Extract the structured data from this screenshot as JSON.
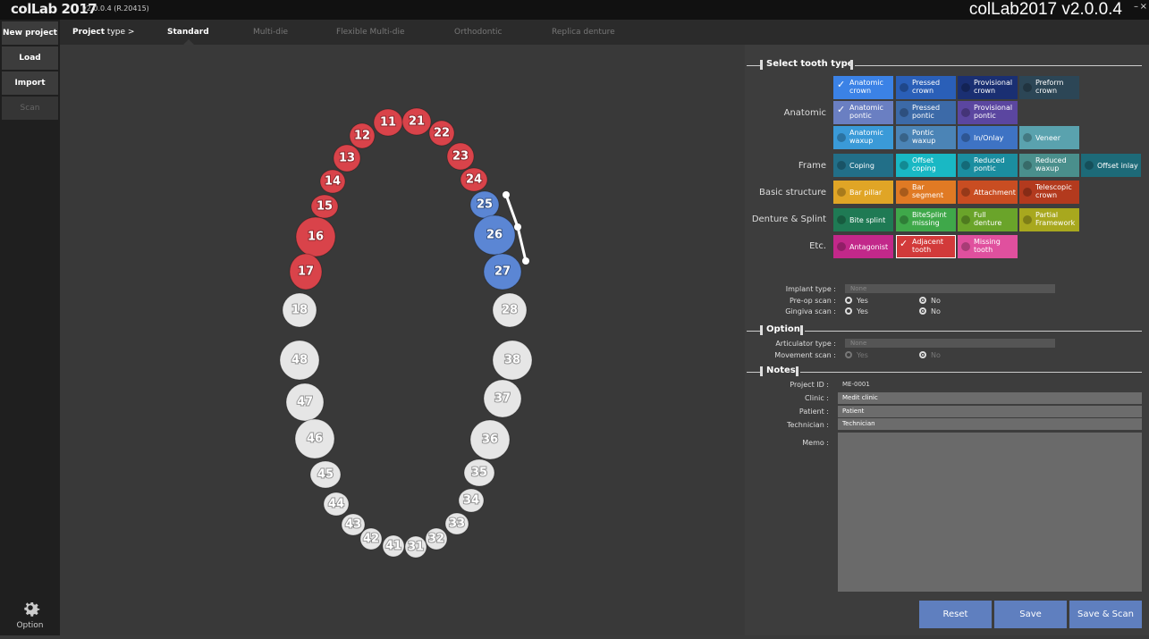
{
  "title": {
    "logo": "colLab 2017",
    "version": "v2.0.0.4 (R.20415)",
    "right_title": "colLab2017 v2.0.0.4",
    "close_glyph": "×",
    "min_glyph": "–"
  },
  "sidebar": {
    "items": [
      {
        "label": "New project"
      },
      {
        "label": "Load"
      },
      {
        "label": "Import"
      },
      {
        "label": "Scan"
      }
    ],
    "option_label": "Option"
  },
  "nav": {
    "project_label": "Project",
    "project_suffix": "type >",
    "tabs": [
      {
        "label": "Standard"
      },
      {
        "label": "Multi-die"
      },
      {
        "label": "Flexible Multi-die"
      },
      {
        "label": "Orthodontic"
      },
      {
        "label": "Replica denture"
      }
    ]
  },
  "teeth": {
    "red": [
      "11",
      "21",
      "12",
      "22",
      "13",
      "23",
      "14",
      "24",
      "15",
      "16",
      "17"
    ],
    "blue": [
      "25",
      "26",
      "27"
    ],
    "white": [
      "18",
      "28",
      "48",
      "38",
      "47",
      "37",
      "46",
      "36",
      "45",
      "35",
      "44",
      "34",
      "43",
      "33",
      "42",
      "32",
      "41",
      "31"
    ]
  },
  "tooth_type": {
    "header": "Select tooth type",
    "rows": [
      {
        "label": "Anatomic"
      },
      {
        "label": "Frame"
      },
      {
        "label": "Basic structure"
      },
      {
        "label": "Denture & Splint"
      },
      {
        "label": "Etc."
      }
    ],
    "buttons": [
      {
        "l1": "Anatomic",
        "l2": "crown",
        "color": "#3b82e6"
      },
      {
        "l1": "Pressed",
        "l2": "crown",
        "color": "#2a5fb8"
      },
      {
        "l1": "Provisional",
        "l2": "crown",
        "color": "#1a2f72"
      },
      {
        "l1": "Preform",
        "l2": "crown",
        "color": "#2c4656"
      },
      {
        "l1": "Anatomic",
        "l2": "pontic",
        "color": "#6a7fc2"
      },
      {
        "l1": "Pressed",
        "l2": "pontic",
        "color": "#3c6aa8"
      },
      {
        "l1": "Provisional",
        "l2": "pontic",
        "color": "#5b46a0"
      },
      {
        "l1": "Anatomic",
        "l2": "waxup",
        "color": "#3a9ad8"
      },
      {
        "l1": "Pontic",
        "l2": "waxup",
        "color": "#4b84b6"
      },
      {
        "l1": "In/Onlay",
        "l2": "",
        "color": "#3e73c4"
      },
      {
        "l1": "Veneer",
        "l2": "",
        "color": "#5aa2ae"
      },
      {
        "l1": "Coping",
        "l2": "",
        "color": "#226f88"
      },
      {
        "l1": "Offset",
        "l2": "coping",
        "color": "#19b8c4"
      },
      {
        "l1": "Reduced",
        "l2": "pontic",
        "color": "#1b8ea0"
      },
      {
        "l1": "Reduced",
        "l2": "waxup",
        "color": "#4a8f8c"
      },
      {
        "l1": "Offset inlay",
        "l2": "",
        "color": "#1d6a78"
      },
      {
        "l1": "Bar pillar",
        "l2": "",
        "color": "#e0a526"
      },
      {
        "l1": "Bar",
        "l2": "segment",
        "color": "#e07a24"
      },
      {
        "l1": "Attachment",
        "l2": "",
        "color": "#c94d22"
      },
      {
        "l1": "Telescopic",
        "l2": "crown",
        "color": "#b33a1e"
      },
      {
        "l1": "Bite splint",
        "l2": "",
        "color": "#1f7a54"
      },
      {
        "l1": "BiteSplint",
        "l2": "missing",
        "color": "#3fa84a"
      },
      {
        "l1": "Full",
        "l2": "denture",
        "color": "#6aa42a"
      },
      {
        "l1": "Partial",
        "l2": "Framework",
        "color": "#a8a81e"
      },
      {
        "l1": "Antagonist",
        "l2": "",
        "color": "#c2288a"
      },
      {
        "l1": "Adjacent",
        "l2": "tooth",
        "color": "#d23a3a"
      },
      {
        "l1": "Missing",
        "l2": "tooth",
        "color": "#e0509e"
      }
    ]
  },
  "implant": {
    "implant_label": "Implant type :",
    "implant_value": "None",
    "preop_label": "Pre-op scan :",
    "gingiva_label": "Gingiva scan :",
    "yes": "Yes",
    "no": "No"
  },
  "option": {
    "header": "Option",
    "articulator_label": "Articulator type :",
    "articulator_value": "None",
    "movement_label": "Movement scan :",
    "yes": "Yes",
    "no": "No"
  },
  "notes": {
    "header": "Notes",
    "project_id_label": "Project ID :",
    "project_id": "ME-0001",
    "clinic_label": "Clinic :",
    "clinic": "Medit clinic",
    "patient_label": "Patient :",
    "patient": "Patient",
    "technician_label": "Technician :",
    "technician": "Technician",
    "memo_label": "Memo :"
  },
  "actions": {
    "reset": "Reset",
    "save": "Save",
    "save_scan": "Save & Scan"
  },
  "colors": {
    "red_tooth": "#d9434a",
    "blue_tooth": "#5b86d4",
    "white_tooth": "#e6e6e6",
    "action_button": "#5f7fbf"
  }
}
